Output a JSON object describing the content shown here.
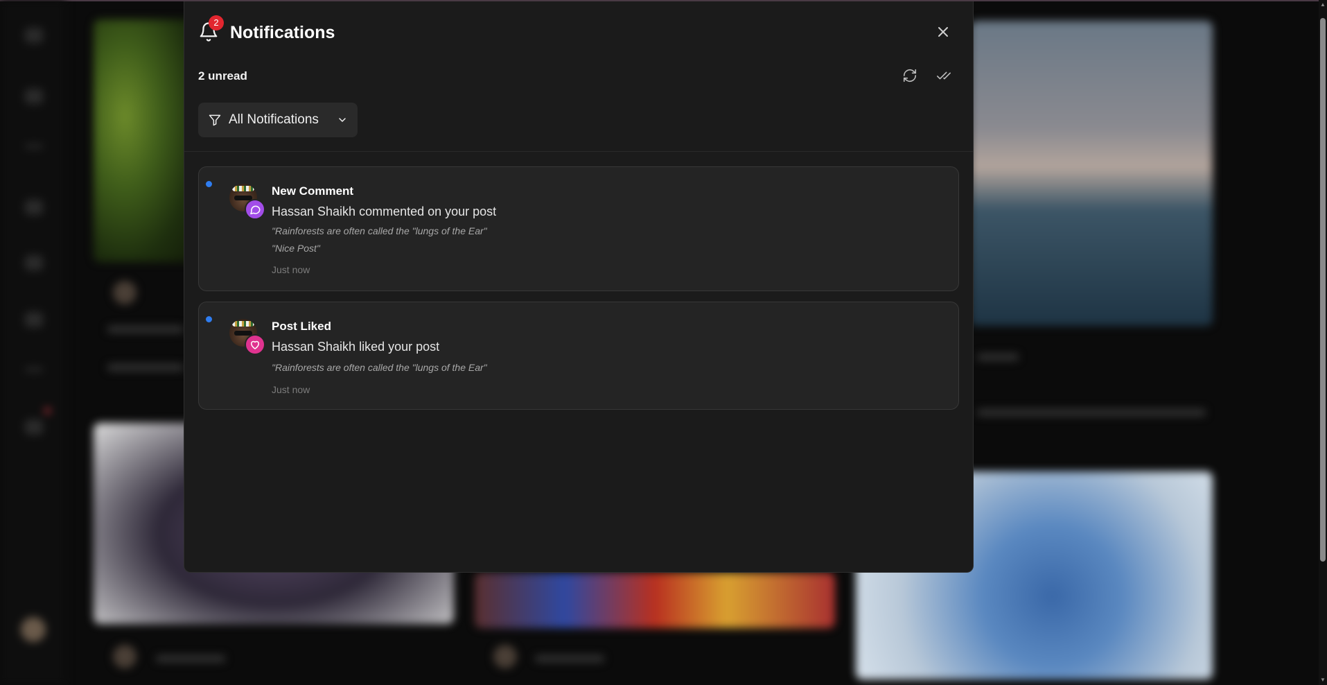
{
  "panel": {
    "title": "Notifications",
    "badge_count": "2",
    "unread_label": "2 unread",
    "filter_label": "All Notifications",
    "icons": {
      "bell": "bell-icon",
      "close": "close-icon",
      "refresh": "refresh-icon",
      "mark_all_read": "double-check-icon",
      "filter": "filter-icon",
      "chevron": "chevron-down-icon"
    }
  },
  "notifications": [
    {
      "title": "New Comment",
      "body": "Hassan Shaikh commented on your post",
      "quote": "\"Rainforests are often called the \"lungs of the Ear\"",
      "comment": "\"Nice Post\"",
      "time": "Just now",
      "unread": true,
      "type_icon": "comment-icon",
      "type_color": "#a24de8"
    },
    {
      "title": "Post Liked",
      "body": "Hassan Shaikh liked your post",
      "quote": "\"Rainforests are often called the \"lungs of the Ear\"",
      "time": "Just now",
      "unread": true,
      "type_icon": "heart-icon",
      "type_color": "#e0338f"
    }
  ],
  "colors": {
    "badge": "#e2262f",
    "unread_dot": "#2f7df0",
    "panel_bg": "#1b1b1b",
    "card_bg": "#242424"
  }
}
